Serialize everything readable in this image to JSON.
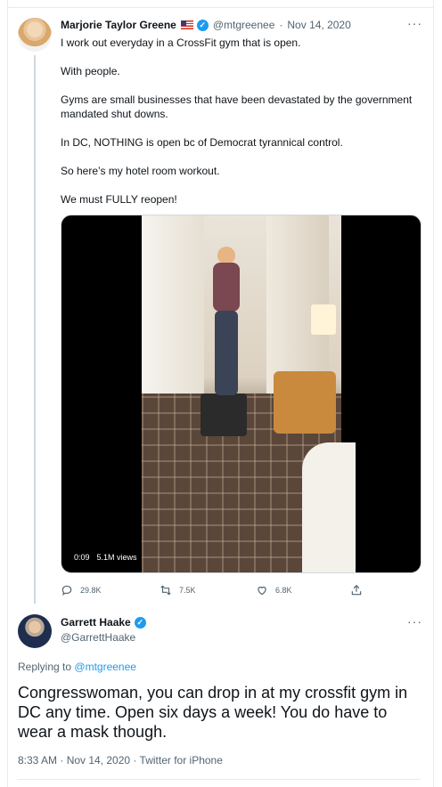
{
  "tweet1": {
    "author_name": "Marjorie Taylor Greene",
    "author_handle": "@mtgreenee",
    "separator": "·",
    "date": "Nov 14, 2020",
    "more_label": "···",
    "lines": [
      "I work out everyday in a CrossFit gym that is open.",
      "With people.",
      "Gyms are small businesses that have been devastated by the government mandated shut downs.",
      "In DC, NOTHING is open bc of Democrat tyrannical control.",
      "So here’s my hotel room workout.",
      "We must FULLY reopen!"
    ],
    "video": {
      "duration": "0:09",
      "views": "5.1M views"
    },
    "actions": {
      "replies": "29.8K",
      "retweets": "7.5K",
      "likes": "6.8K"
    }
  },
  "tweet2": {
    "author_name": "Garrett Haake",
    "author_handle": "@GarrettHaake",
    "more_label": "···",
    "replying_prefix": "Replying to",
    "replying_to": "@mtgreenee",
    "body": "Congresswoman, you can drop in at my crossfit gym in DC any time. Open six days a week! You do have to wear a mask though.",
    "meta": "8:33 AM · Nov 14, 2020 · Twitter for iPhone"
  },
  "colors": {
    "accent": "#1d9bf0",
    "muted": "#536471",
    "text": "#0f1419",
    "divider": "#e6ecf0"
  },
  "icons": [
    "reply-icon",
    "retweet-icon",
    "like-icon",
    "share-icon",
    "verified-badge-icon",
    "us-flag-icon",
    "more-icon"
  ]
}
